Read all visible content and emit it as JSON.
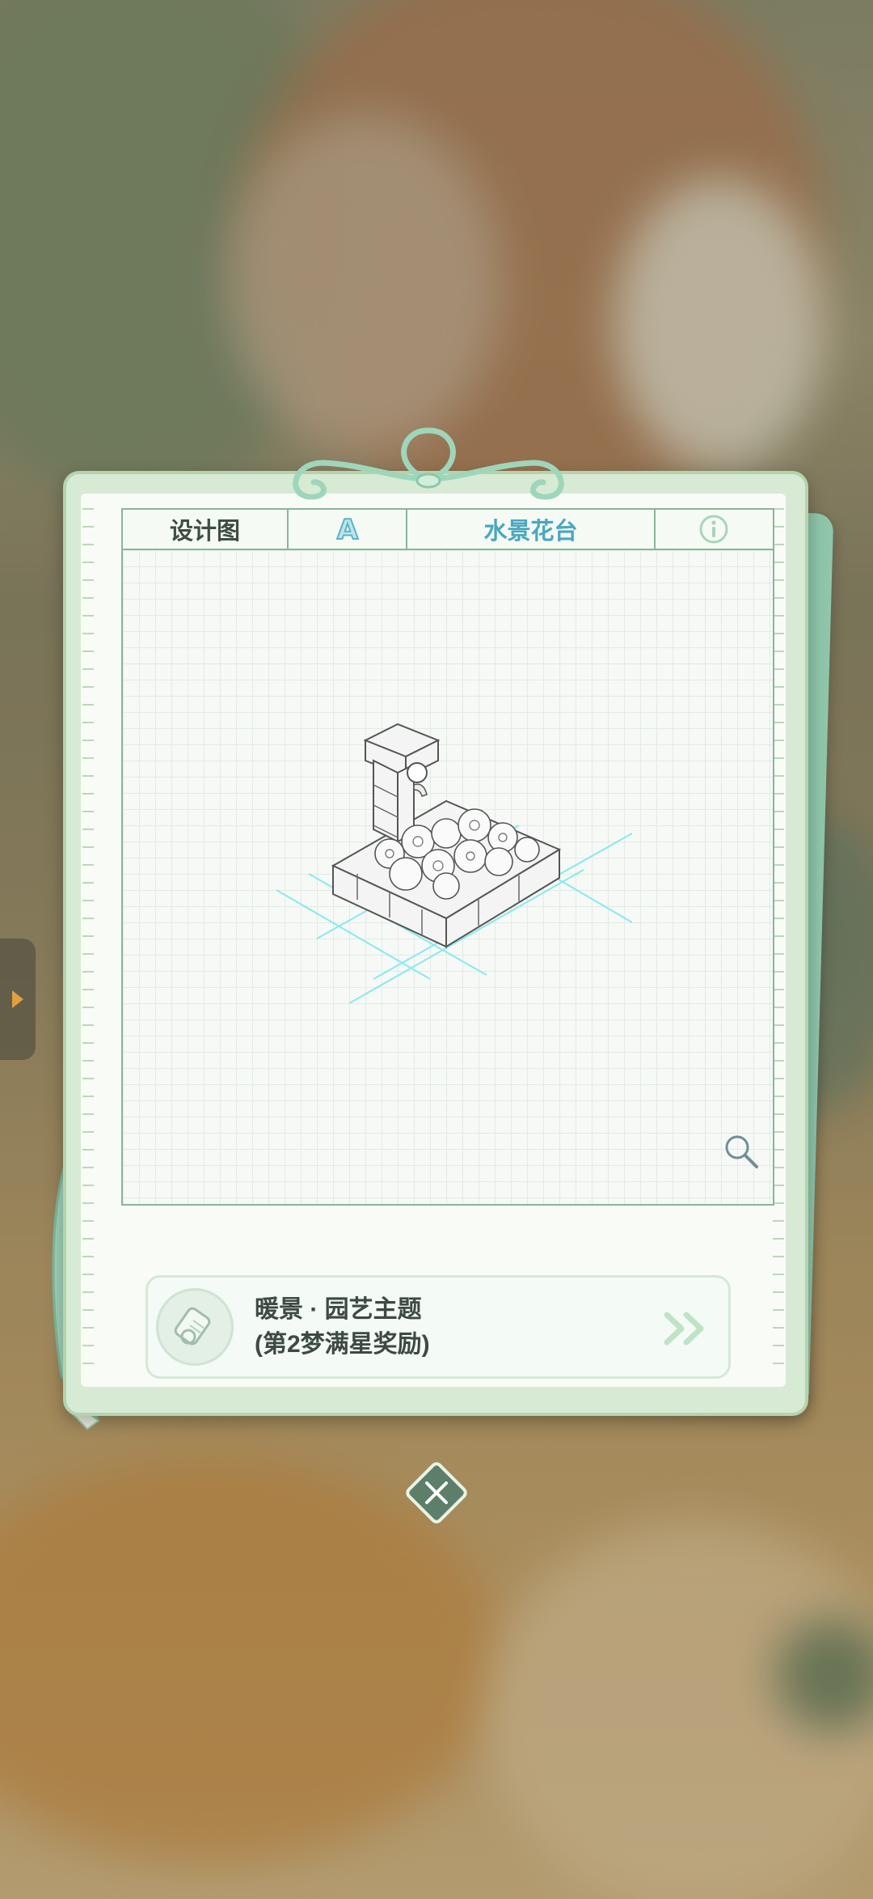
{
  "header": {
    "title": "设计图",
    "grade": "A",
    "item_name": "水景花台",
    "info_icon": "info-icon"
  },
  "reward": {
    "line1": "暖景 · 园艺主题",
    "line2": "(第2梦满星奖励)",
    "icon": "scroll-icon",
    "arrow_icon": "double-chevron-right-icon"
  },
  "controls": {
    "zoom_icon": "magnifier-icon",
    "close_icon": "close-icon",
    "side_tab_icon": "triangle-right-icon"
  },
  "colors": {
    "accent": "#4aa7c0",
    "frame": "#8bb59a",
    "close_bg": "#5d7f6a",
    "text_dark": "#3d4a42"
  }
}
